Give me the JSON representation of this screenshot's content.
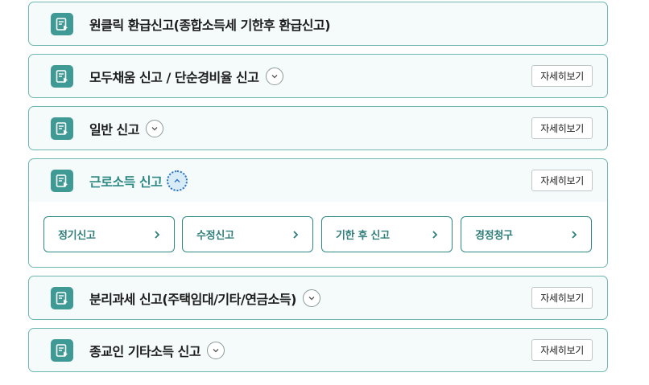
{
  "items": [
    {
      "title": "원클릭 환급신고(종합소득세 기한후 환급신고)",
      "has_toggle": false,
      "has_detail": false,
      "expanded": false
    },
    {
      "title": "모두채움 신고 / 단순경비율 신고",
      "has_toggle": true,
      "has_detail": true,
      "detail_label": "자세히보기",
      "expanded": false
    },
    {
      "title": "일반 신고",
      "has_toggle": true,
      "has_detail": true,
      "detail_label": "자세히보기",
      "expanded": false
    },
    {
      "title": "근로소득 신고",
      "has_toggle": true,
      "has_detail": true,
      "detail_label": "자세히보기",
      "expanded": true,
      "sub_options": [
        "정기신고",
        "수정신고",
        "기한 후 신고",
        "경정청구"
      ]
    },
    {
      "title": "분리과세 신고(주택임대/기타/연금소득)",
      "has_toggle": true,
      "has_detail": true,
      "detail_label": "자세히보기",
      "expanded": false
    },
    {
      "title": "종교인 기타소득 신고",
      "has_toggle": true,
      "has_detail": true,
      "detail_label": "자세히보기",
      "expanded": false
    }
  ],
  "colors": {
    "accent": "#3f9a95",
    "border": "#6fb7b3",
    "card_bg": "#f4fbfa",
    "open_title": "#2f8a86"
  },
  "icons": {
    "card": "document-play-icon",
    "toggle_collapsed": "chevron-down-icon",
    "toggle_expanded": "chevron-up-icon",
    "sub_arrow": "chevron-right-icon"
  }
}
